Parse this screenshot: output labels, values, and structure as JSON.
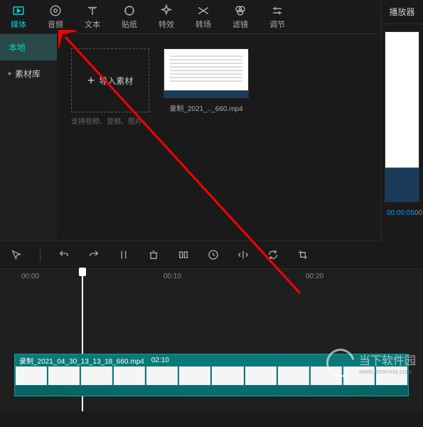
{
  "top_tabs": [
    {
      "name": "media",
      "label": "媒体",
      "active": true
    },
    {
      "name": "audio",
      "label": "音频"
    },
    {
      "name": "text",
      "label": "文本"
    },
    {
      "name": "sticker",
      "label": "贴纸"
    },
    {
      "name": "effect",
      "label": "特效"
    },
    {
      "name": "transition",
      "label": "转场"
    },
    {
      "name": "filter",
      "label": "滤镜"
    },
    {
      "name": "adjust",
      "label": "调节"
    }
  ],
  "sidebar": {
    "items": [
      {
        "name": "local",
        "label": "本地",
        "active": true
      },
      {
        "name": "library",
        "label": "素材库",
        "has_chevron": true
      }
    ]
  },
  "import": {
    "title": "导入素材",
    "subtitle": "支持视频、音频、图片",
    "plus": "+"
  },
  "media": {
    "thumb_name": "录制_2021_.._660.mp4"
  },
  "player": {
    "title": "播放器",
    "time_current": "00:00:05",
    "time_total": "00"
  },
  "timeline": {
    "ticks": [
      "00:00",
      "00:10",
      "00:20"
    ],
    "clip_name": "录制_2021_04_30_13_13_18_660.mp4",
    "clip_duration": "02:10"
  },
  "watermark": {
    "main": "当下软件园",
    "sub": "www.downxia.com"
  }
}
